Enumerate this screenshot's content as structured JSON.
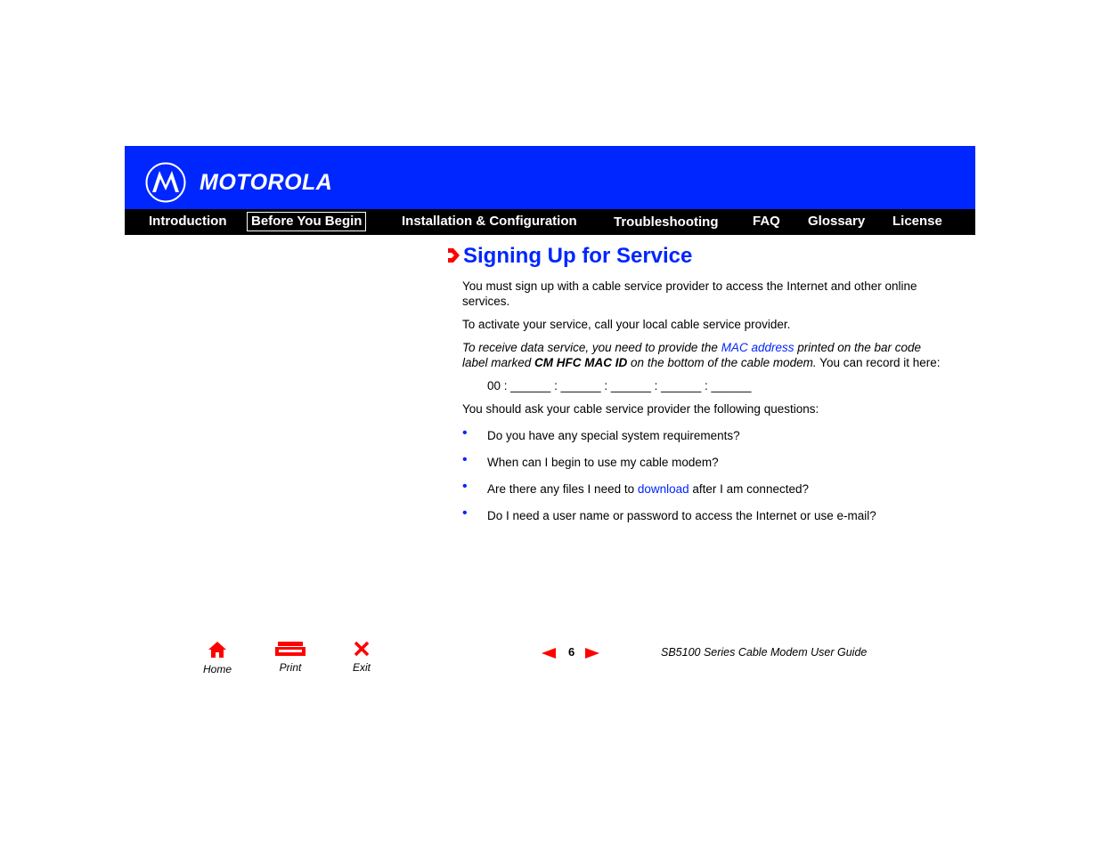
{
  "brand": {
    "name": "MOTOROLA",
    "logo_icon": "motorola-batwing-icon",
    "color": "#0026ff"
  },
  "nav": {
    "items": [
      {
        "label": "Introduction"
      },
      {
        "label": "Before You Begin",
        "active": true
      },
      {
        "label": "Installation & Configuration"
      },
      {
        "label": "Troubleshooting"
      },
      {
        "label": "FAQ"
      },
      {
        "label": "Glossary"
      },
      {
        "label": "License"
      }
    ]
  },
  "page": {
    "title": "Signing Up for Service",
    "p1": "You must sign up with a cable service provider to access the Internet and other online services.",
    "p2": "To activate your service, call your local cable service provider.",
    "p3": {
      "t1": "To receive data service, you need to provide the ",
      "link": "MAC address",
      "t2": " printed on the bar code label marked ",
      "bold": "CM HFC MAC ID",
      "t3": " on the bottom of the cable modem.",
      "t4": " You can record it here:"
    },
    "mac_line": "00 : ______ : ______ : ______ : ______ : ______",
    "p4": "You should ask your cable service provider the following questions:",
    "bullets": {
      "b1": "Do you have any special system requirements?",
      "b2": "When can I begin to use my cable modem?",
      "b3_pre": "Are there any files I need to ",
      "b3_link": "download",
      "b3_post": " after I am connected?",
      "b4": "Do I need a user name or password to access the Internet or use e-mail?"
    }
  },
  "footer": {
    "home": "Home",
    "print": "Print",
    "exit": "Exit",
    "page_number": "6",
    "guide_title": "SB5100 Series Cable Modem User Guide"
  },
  "colors": {
    "accent": "#0026ff",
    "nav_bg": "#000000",
    "icon_red": "#ff0000"
  }
}
